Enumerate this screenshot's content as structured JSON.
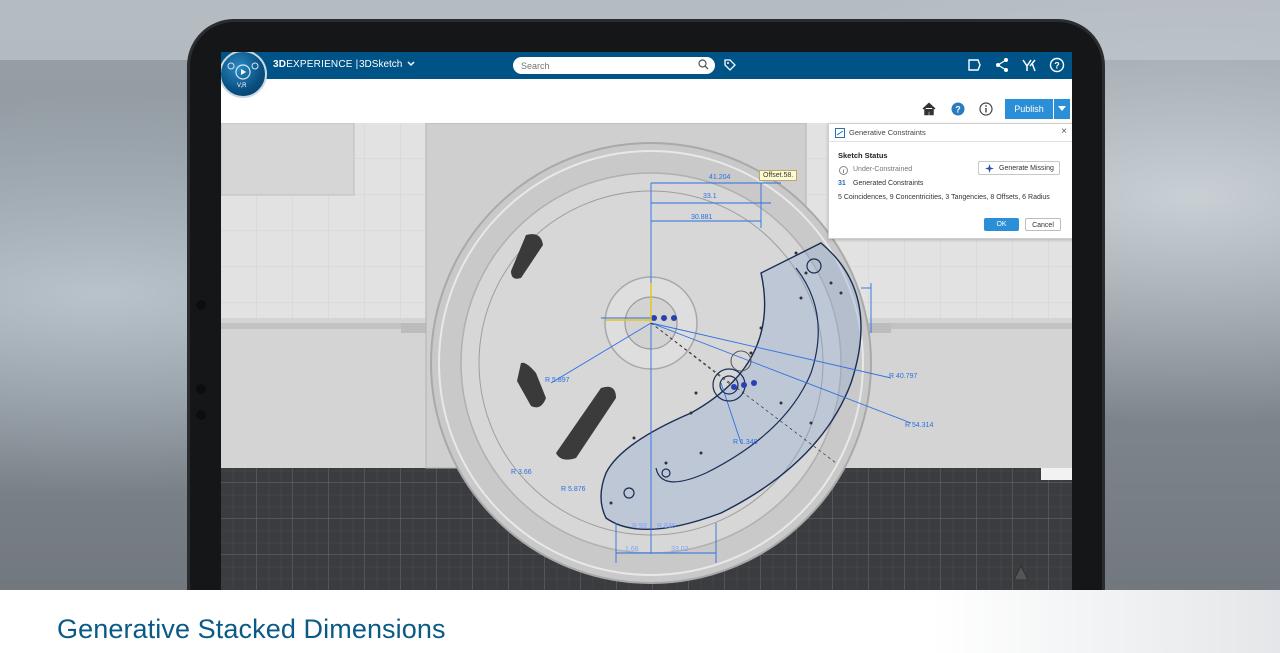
{
  "topbar": {
    "brand_bold": "3D",
    "brand_rest": "EXPERIENCE |",
    "app_name": "3DSketch",
    "search_placeholder": "Search",
    "compass_label": "V,R",
    "icons": [
      "compass-icon",
      "chevron-down-icon",
      "search-icon",
      "tag-icon",
      "speech-bubble-icon",
      "share-icon",
      "collaborate-icon",
      "help-icon"
    ]
  },
  "subbar": {
    "publish_label": "Publish",
    "icons": [
      "home-icon",
      "help-icon",
      "info-icon",
      "caret-down-icon"
    ]
  },
  "viewport": {
    "dimensions": [
      "41.204",
      "33.1",
      "30.881",
      "R 5.897",
      "R 40.797",
      "R 54.314",
      "R 1.348",
      "R 3.66",
      "R 5.876",
      "R 93",
      "R 836",
      "1.66",
      "33.02"
    ],
    "tooltip": "Offset.58."
  },
  "panel": {
    "title": "Generative Constraints",
    "section": "Sketch Status",
    "status": "Under-Constrained",
    "generate_label": "Generate Missing",
    "count": "31",
    "count_label": "Generated Constraints",
    "details": "5 Coincidences, 9 Concentricities, 3 Tangencies, 8 Offsets, 6 Radius",
    "ok_label": "OK",
    "cancel_label": "Cancel"
  },
  "caption": "Generative Stacked Dimensions",
  "colors": {
    "topbar": "#005386",
    "accent": "#2a8fd6",
    "caption": "#0a5a86"
  }
}
